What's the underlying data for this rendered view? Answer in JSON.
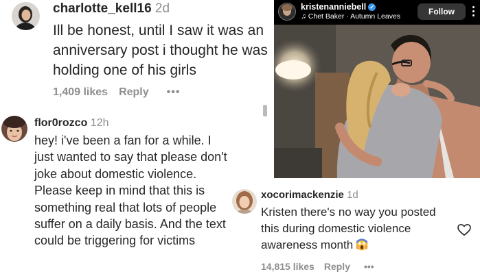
{
  "comments": [
    {
      "username": "charlotte_kell16",
      "time": "2d",
      "text": "Ill be honest, until I saw it was an anniversary post i thought he was holding one of his girls",
      "likes": "1,409 likes",
      "reply": "Reply",
      "more": "•••"
    },
    {
      "username": "flor0rozco",
      "time": "12h",
      "text": "hey! i've been a fan for a while. I just wanted to say that please don't joke about domestic violence. Please keep in mind that this is something real that lots of people suffer on a daily basis. And the text could be triggering for victims"
    },
    {
      "username": "xocorimackenzie",
      "time": "1d",
      "text": "Kristen there's no way you posted this during domestic violence awareness month",
      "likes": "14,815 likes",
      "reply": "Reply",
      "more": "•••"
    }
  ],
  "post": {
    "username": "kristenanniebell",
    "music_icon": "music-note-icon",
    "music": "Chet Baker · Autumn Leaves",
    "follow_label": "Follow",
    "verified_icon": "verified-badge-icon"
  }
}
